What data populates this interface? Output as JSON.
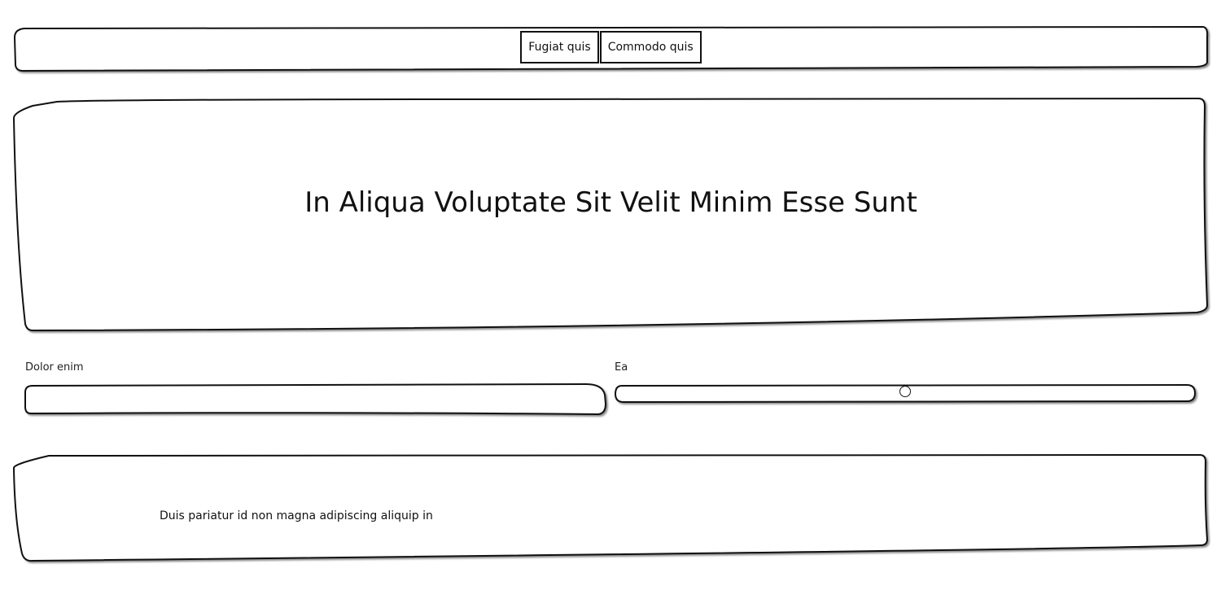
{
  "nav": {
    "buttons": [
      {
        "label": "Fugiat quis"
      },
      {
        "label": "Commodo quis"
      }
    ]
  },
  "hero": {
    "title": "In Aliqua Voluptate Sit Velit Minim Esse Sunt"
  },
  "form": {
    "text_field": {
      "label": "Dolor enim",
      "value": "",
      "placeholder": ""
    },
    "slider": {
      "label": "Ea",
      "value_fraction": 0.5
    }
  },
  "footer": {
    "text": "Duis pariatur id non magna adipiscing aliquip in"
  }
}
